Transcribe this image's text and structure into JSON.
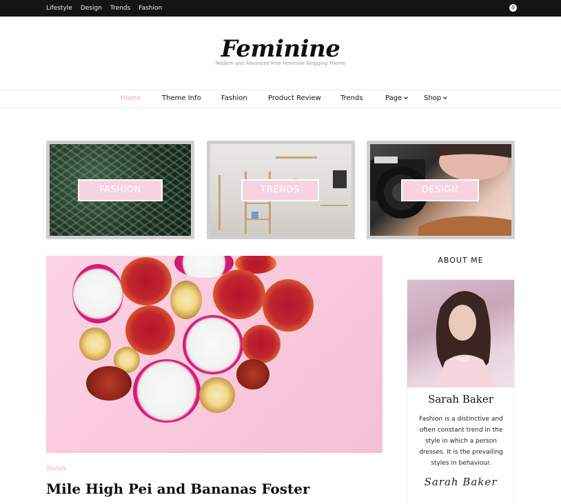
{
  "topbar": {
    "links": [
      "Lifestyle",
      "Design",
      "Trends",
      "Fashion"
    ],
    "cart_count": "0"
  },
  "brand": {
    "title": "Feminine",
    "tagline": "Modern and Advanced Free Feminine Blogging Theme"
  },
  "nav": {
    "items": [
      {
        "label": "Home",
        "active": true
      },
      {
        "label": "Theme Info"
      },
      {
        "label": "Fashion"
      },
      {
        "label": "Product Review"
      },
      {
        "label": "Trends"
      },
      {
        "label": "Page",
        "has_dropdown": true
      },
      {
        "label": "Shop",
        "has_dropdown": true
      }
    ]
  },
  "categories": [
    {
      "label": "FASHION"
    },
    {
      "label": "TRENDS"
    },
    {
      "label": "DESIGN"
    }
  ],
  "post": {
    "category": "Trends",
    "title": "Mile High Pei and Bananas Foster"
  },
  "sidebar": {
    "about_title": "ABOUT ME",
    "name": "Sarah Baker",
    "bio": "Fashion is a distinctive and often constant trend in the style in which a person dresses. It is the prevailing styles in behaviour.",
    "signature": "Sarah Baker"
  },
  "colors": {
    "accent": "#f3a8c0",
    "label_bg": "#f7d3e1",
    "topbar_bg": "#141414"
  }
}
